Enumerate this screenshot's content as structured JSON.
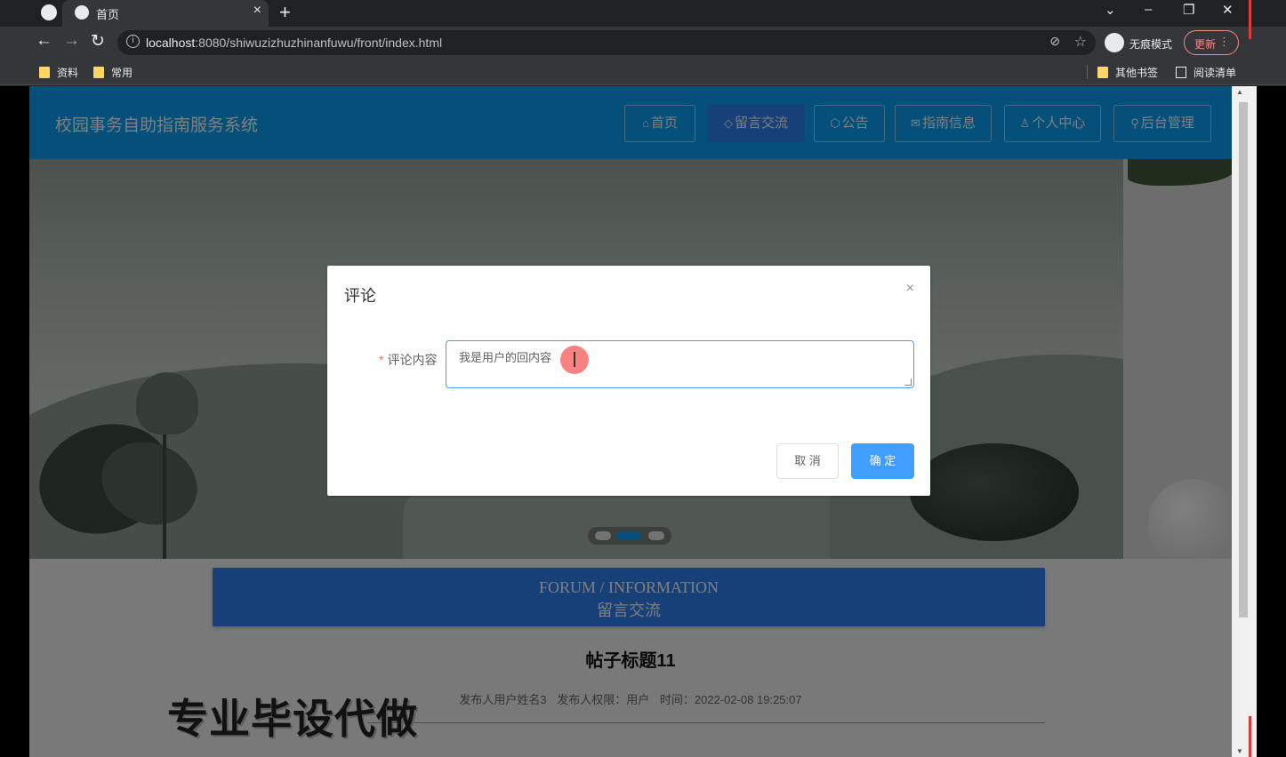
{
  "browser": {
    "tab_title": "首页",
    "tab_close": "×",
    "new_tab": "+",
    "url_host": "localhost",
    "url_rest": ":8080/shiwuzizhuzhinanfuwu/front/index.html",
    "incognito_label": "无痕模式",
    "update_label": "更新",
    "bookmarks": [
      {
        "label": "资料"
      },
      {
        "label": "常用"
      }
    ],
    "other_bookmarks": "其他书签",
    "reading_list": "阅读清单"
  },
  "site": {
    "title": "校园事务自助指南服务系统",
    "nav": [
      {
        "icon": "⌂",
        "label": "首页",
        "active": false
      },
      {
        "icon": "◇",
        "label": "留言交流",
        "active": true
      },
      {
        "icon": "⬡",
        "label": "公告",
        "active": false
      },
      {
        "icon": "✉",
        "label": "指南信息",
        "active": false
      },
      {
        "icon": "♙",
        "label": "个人中心",
        "active": false
      },
      {
        "icon": "⚲",
        "label": "后台管理",
        "active": false
      }
    ]
  },
  "forum": {
    "en": "FORUM / INFORMATION",
    "cn": "留言交流"
  },
  "post": {
    "title": "帖子标题11",
    "author": "发布人用户姓名3",
    "role": "发布人权限：用户",
    "time": "时间：2022-02-08 19:25:07"
  },
  "watermark": "专业毕设代做",
  "dialog": {
    "title": "评论",
    "close": "×",
    "required_mark": "*",
    "field_label": "评论内容",
    "field_value": "我是用户的回内容",
    "cancel_label": "取 消",
    "confirm_label": "确 定"
  },
  "colors": {
    "header_bg": "#0aa0f5",
    "nav_active": "#2f7ff0",
    "primary": "#409eff"
  }
}
